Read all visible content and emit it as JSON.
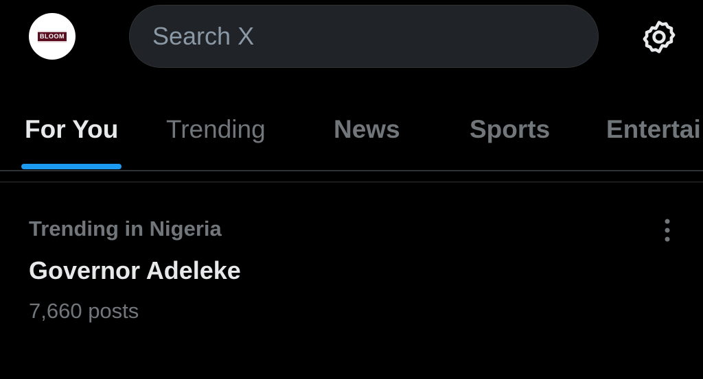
{
  "header": {
    "avatar_text": "BLOOM",
    "search_placeholder": "Search X",
    "settings_icon": "gear-icon"
  },
  "tabs": [
    {
      "label": "For You",
      "active": true
    },
    {
      "label": "Trending",
      "active": false
    },
    {
      "label": "News",
      "active": false
    },
    {
      "label": "Sports",
      "active": false
    },
    {
      "label": "Entertai",
      "active": false
    }
  ],
  "trend": {
    "context": "Trending in Nigeria",
    "title": "Governor Adeleke",
    "count": "7,660 posts",
    "more_icon": "more-vertical-icon"
  },
  "colors": {
    "background": "#000000",
    "accent": "#1d9bf0",
    "primary_text": "#e7e9ea",
    "secondary_text": "#71767b",
    "search_bg": "#202327"
  }
}
